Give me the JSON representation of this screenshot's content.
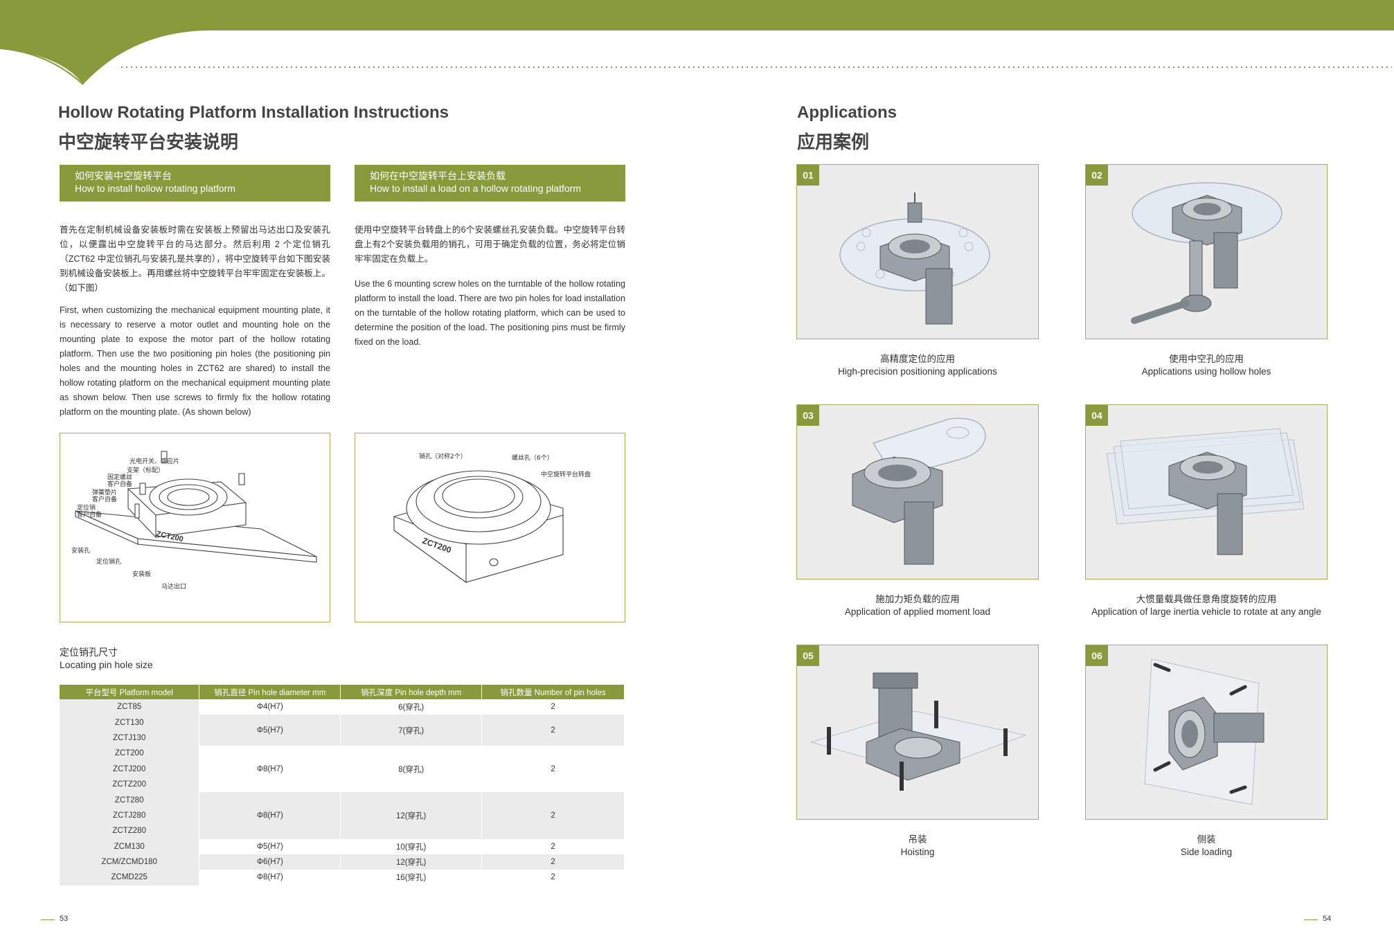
{
  "colors": {
    "accent": "#889a3c",
    "border": "#a2b15e",
    "panel": "#ececec"
  },
  "left": {
    "title_en": "Hollow Rotating Platform Installation Instructions",
    "title_cn": "中空旋转平台安装说明",
    "box1": {
      "cn": "如何安装中空旋转平台",
      "en": "How to install hollow rotating platform"
    },
    "box2": {
      "cn": "如何在中空旋转平台上安装负载",
      "en": "How to install a load on a hollow rotating platform"
    },
    "para1_cn": "首先在定制机械设备安装板时需在安装板上预留出马达出口及安装孔位，以便露出中空旋转平台的马达部分。然后利用 2 个定位销孔（ZCT62 中定位销孔与安装孔是共享的），将中空旋转平台如下图安装到机械设备安装板上。再用螺丝将中空旋转平台牢牢固定在安装板上。（如下图）",
    "para1_en": "First, when customizing the mechanical equipment mounting plate, it is necessary to reserve a motor outlet and mounting hole on the mounting plate to expose the motor part of the hollow rotating platform. Then use the two positioning pin holes (the positioning pin holes and the mounting holes in ZCT62 are shared) to install the hollow rotating platform on the mechanical equipment mounting plate as shown below. Then use screws to firmly fix the hollow rotating platform on the mounting plate. (As shown below)",
    "para2_cn": "使用中空旋转平台转盘上的6个安装螺丝孔安装负载。中空旋转平台转盘上有2个安装负载用的销孔，可用于确定负载的位置，务必将定位销牢牢固定在负载上。",
    "para2_en": "Use the 6 mounting screw holes on the turntable of the hollow rotating platform to install the load. There are two pin holes for load installation on the turntable of the hollow rotating platform, which can be used to determine the position of the load. The positioning pins must be firmly fixed on the load.",
    "diagram1": {
      "labels": [
        "光电开关、感应片",
        "支架（标配）",
        "固定螺丝",
        "客户自备",
        "弹簧垫片",
        "客户自备",
        "定位销",
        "客户自备",
        "安装孔",
        "定位销孔",
        "安装板",
        "马达出口"
      ],
      "model": "ZCT200"
    },
    "diagram2": {
      "labels": [
        "销孔（对称2个）",
        "螺丝孔（6个）",
        "中空旋转平台转盘"
      ],
      "model": "ZCT200"
    },
    "pin_title_cn": "定位销孔尺寸",
    "pin_title_en": "Locating pin hole size",
    "table": {
      "headers": [
        "平台型号  Platform model",
        "销孔直径 Pin hole diameter mm",
        "销孔深度 Pin hole depth mm",
        "销孔数量 Number of pin holes"
      ],
      "models": [
        "ZCT85",
        "ZCT130",
        "ZCTJ130",
        "ZCT200",
        "ZCTJ200",
        "ZCTZ200",
        "ZCT280",
        "ZCTJ280",
        "ZCTZ280",
        "ZCM130",
        "ZCM/ZCMD180",
        "ZCMD225"
      ],
      "groups": [
        {
          "diameter": "Φ4(H7)",
          "depth": "6(穿孔)",
          "count": "2"
        },
        {
          "diameter": "Φ5(H7)",
          "depth": "7(穿孔)",
          "count": "2"
        },
        {
          "diameter": "Φ8(H7)",
          "depth": "8(穿孔)",
          "count": "2"
        },
        {
          "diameter": "Φ8(H7)",
          "depth": "12(穿孔)",
          "count": "2"
        },
        {
          "diameter": "Φ5(H7)",
          "depth": "10(穿孔)",
          "count": "2"
        },
        {
          "diameter": "Φ6(H7)",
          "depth": "12(穿孔)",
          "count": "2"
        },
        {
          "diameter": "Φ8(H7)",
          "depth": "16(穿孔)",
          "count": "2"
        }
      ]
    },
    "page": "53"
  },
  "right": {
    "title_en": "Applications",
    "title_cn": "应用案例",
    "apps": [
      {
        "num": "01",
        "cn": "高精度定位的应用",
        "en": "High-precision positioning applications",
        "icon": "turntable-with-probe"
      },
      {
        "num": "02",
        "cn": "使用中空孔的应用",
        "en": "Applications using hollow holes",
        "icon": "turntable-with-tube"
      },
      {
        "num": "03",
        "cn": "施加力矩负载的应用",
        "en": "Application of applied moment load",
        "icon": "turntable-with-arm"
      },
      {
        "num": "04",
        "cn": "大惯量载具做任意角度旋转的应用",
        "en": "Application of large inertia vehicle to rotate at any angle",
        "icon": "turntable-with-plates"
      },
      {
        "num": "05",
        "cn": "吊装",
        "en": "Hoisting",
        "icon": "hoisting-mount"
      },
      {
        "num": "06",
        "cn": "侧装",
        "en": "Side loading",
        "icon": "side-mount"
      }
    ],
    "page": "54"
  }
}
